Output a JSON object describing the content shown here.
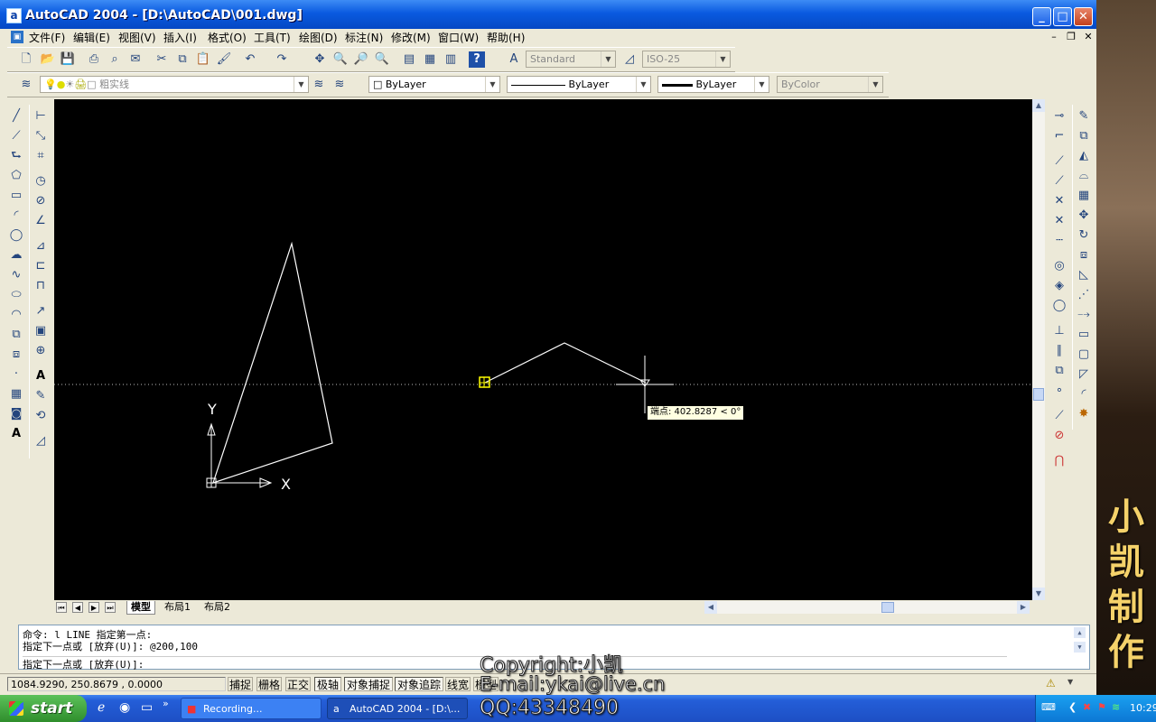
{
  "window": {
    "title": "AutoCAD 2004 - [D:\\AutoCAD\\001.dwg]",
    "app_icon": "a"
  },
  "menu": [
    "文件(F)",
    "编辑(E)",
    "视图(V)",
    "插入(I)",
    "格式(O)",
    "工具(T)",
    "绘图(D)",
    "标注(N)",
    "修改(M)",
    "窗口(W)",
    "帮助(H)"
  ],
  "toolbar": {
    "text_style": "Standard",
    "dim_style": "ISO-25",
    "layer": "粗实线",
    "color": "ByLayer",
    "linetype": "ByLayer",
    "lineweight": "ByLayer",
    "plotstyle": "ByColor"
  },
  "canvas": {
    "ucs_x": "X",
    "ucs_y": "Y",
    "tooltip": "端点: 402.8287 < 0°"
  },
  "layout_tabs": [
    "模型",
    "布局1",
    "布局2"
  ],
  "command": {
    "lines": [
      "命令: l LINE 指定第一点:",
      "指定下一点或 [放弃(U)]: @200,100",
      "指定下一点或 [放弃(U)]:"
    ]
  },
  "status": {
    "coords": "1084.9290, 250.8679 , 0.0000",
    "buttons": [
      "捕捉",
      "栅格",
      "正交",
      "极轴",
      "对象捕捉",
      "对象追踪",
      "线宽",
      "模型"
    ]
  },
  "taskbar": {
    "start": "start",
    "tasks": [
      "Recording...",
      "AutoCAD 2004 - [D:\\..."
    ],
    "clock": "10:29"
  },
  "overlay": {
    "copyright": "Copyright:小凯",
    "email": "E-mail:ykai@live.cn",
    "qq": "QQ:43348490",
    "brand_chars": [
      "小",
      "凯",
      "制",
      "作"
    ]
  }
}
